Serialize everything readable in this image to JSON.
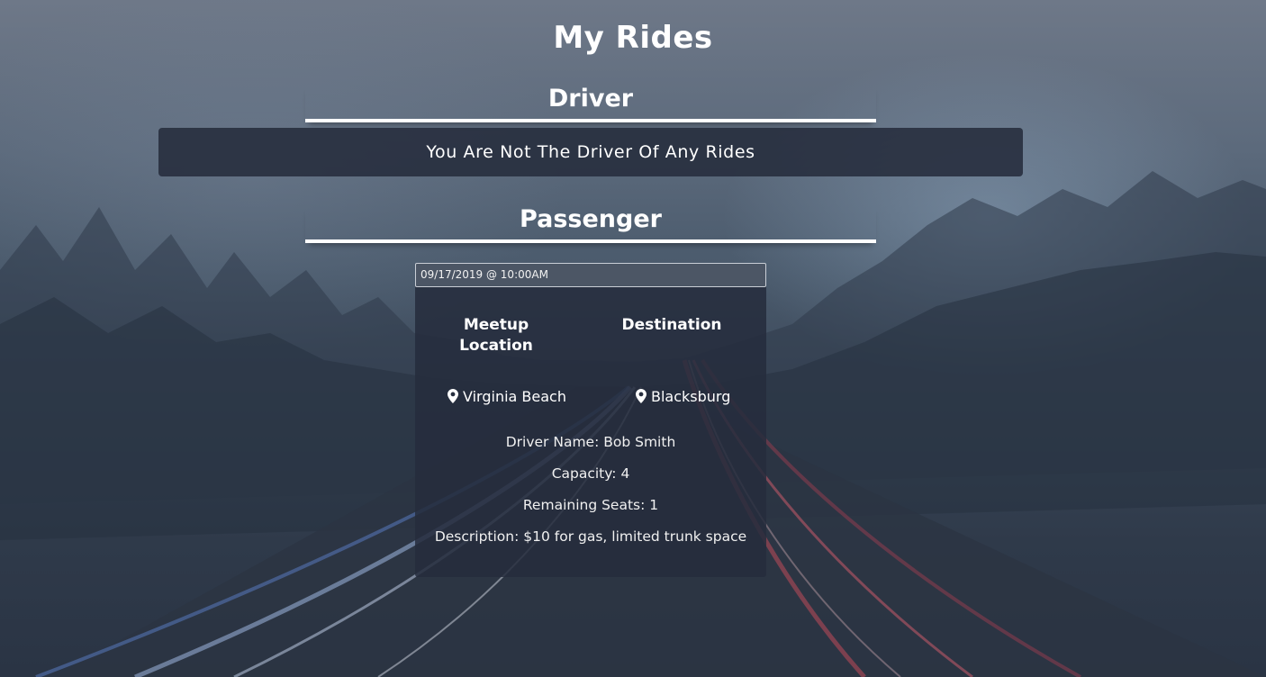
{
  "page": {
    "title": "My Rides"
  },
  "driver_section": {
    "heading": "Driver",
    "empty_message": "You Are Not The Driver Of Any Rides"
  },
  "passenger_section": {
    "heading": "Passenger",
    "rides": [
      {
        "datetime": "09/17/2019 @ 10:00AM",
        "meetup_heading": "Meetup Location",
        "destination_heading": "Destination",
        "meetup_location": "Virginia Beach",
        "destination": "Blacksburg",
        "location_icon": "map-marker-icon",
        "driver_name": "Driver Name: Bob Smith",
        "capacity": "Capacity: 4",
        "remaining_seats": "Remaining Seats: 1",
        "description": "Description: $10 for gas, limited trunk space"
      }
    ]
  },
  "colors": {
    "text": "#ffffff",
    "panel": "#252c3c"
  }
}
